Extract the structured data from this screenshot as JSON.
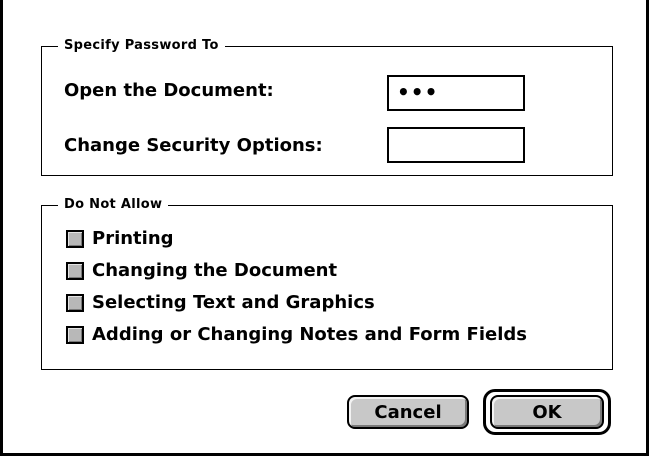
{
  "password_group": {
    "title": "Specify Password To",
    "open_label": "Open the Document:",
    "open_value": "•••",
    "change_label": "Change Security Options:",
    "change_value": ""
  },
  "restrictions_group": {
    "title": "Do Not Allow",
    "items": [
      {
        "label": "Printing",
        "checked": false
      },
      {
        "label": "Changing the Document",
        "checked": false
      },
      {
        "label": "Selecting Text and Graphics",
        "checked": false
      },
      {
        "label": "Adding or Changing Notes and Form Fields",
        "checked": false
      }
    ]
  },
  "buttons": {
    "cancel_label": "Cancel",
    "ok_label": "OK"
  },
  "colors": {
    "checkbox_fill": "#b8b8b8",
    "button_fill": "#c8c8c8"
  }
}
